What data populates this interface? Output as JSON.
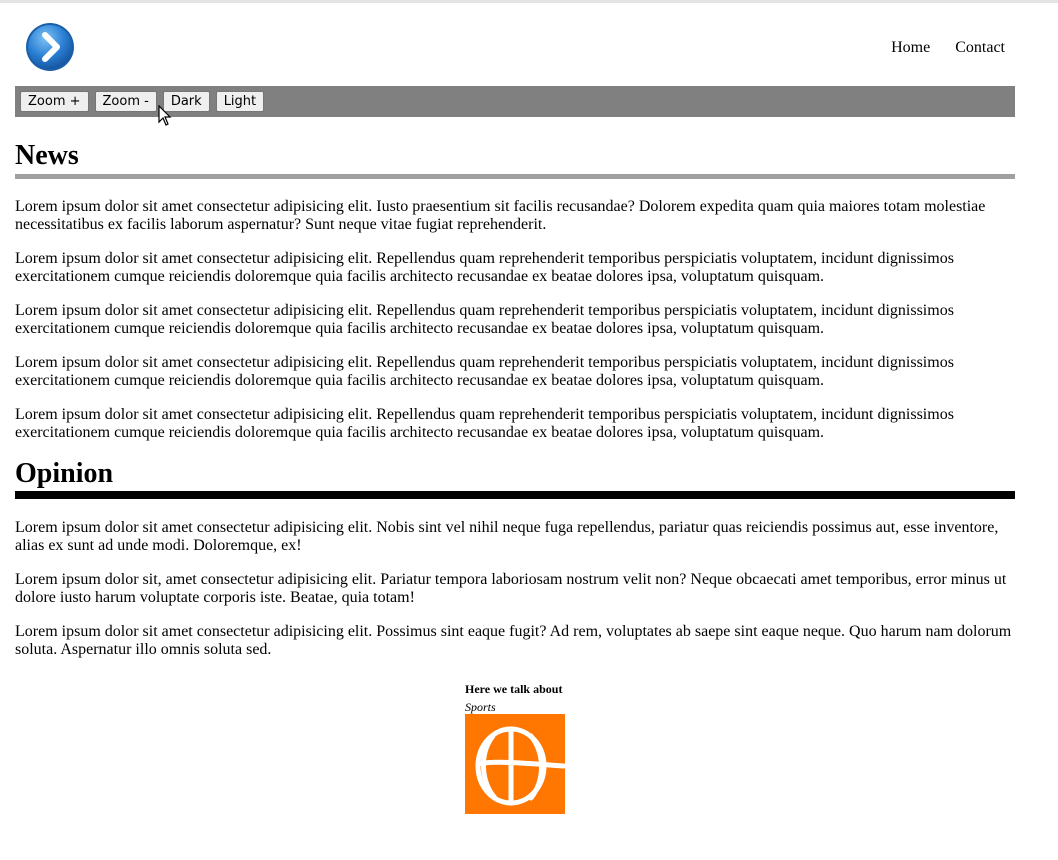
{
  "nav": {
    "home": "Home",
    "contact": "Contact"
  },
  "toolbar": {
    "zoom_in": "Zoom +",
    "zoom_out": "Zoom -",
    "dark": "Dark",
    "light": "Light"
  },
  "news": {
    "title": "News",
    "paragraphs": [
      "Lorem ipsum dolor sit amet consectetur adipisicing elit. Iusto praesentium sit facilis recusandae? Dolorem expedita quam quia maiores totam molestiae necessitatibus ex facilis laborum aspernatur? Sunt neque vitae fugiat reprehenderit.",
      "Lorem ipsum dolor sit amet consectetur adipisicing elit. Repellendus quam reprehenderit temporibus perspiciatis voluptatem, incidunt dignissimos exercitationem cumque reiciendis doloremque quia facilis architecto recusandae ex beatae dolores ipsa, voluptatum quisquam.",
      "Lorem ipsum dolor sit amet consectetur adipisicing elit. Repellendus quam reprehenderit temporibus perspiciatis voluptatem, incidunt dignissimos exercitationem cumque reiciendis doloremque quia facilis architecto recusandae ex beatae dolores ipsa, voluptatum quisquam.",
      "Lorem ipsum dolor sit amet consectetur adipisicing elit. Repellendus quam reprehenderit temporibus perspiciatis voluptatem, incidunt dignissimos exercitationem cumque reiciendis doloremque quia facilis architecto recusandae ex beatae dolores ipsa, voluptatum quisquam.",
      "Lorem ipsum dolor sit amet consectetur adipisicing elit. Repellendus quam reprehenderit temporibus perspiciatis voluptatem, incidunt dignissimos exercitationem cumque reiciendis doloremque quia facilis architecto recusandae ex beatae dolores ipsa, voluptatum quisquam."
    ]
  },
  "opinion": {
    "title": "Opinion",
    "paragraphs": [
      "Lorem ipsum dolor sit amet consectetur adipisicing elit. Nobis sint vel nihil neque fuga repellendus, pariatur quas reiciendis possimus aut, esse inventore, alias ex sunt ad unde modi. Doloremque, ex!",
      "Lorem ipsum dolor sit, amet consectetur adipisicing elit. Pariatur tempora laboriosam nostrum velit non? Neque obcaecati amet temporibus, error minus ut dolore iusto harum voluptate corporis iste. Beatae, quia totam!",
      "Lorem ipsum dolor sit amet consectetur adipisicing elit. Possimus sint eaque fugit? Ad rem, voluptates ab saepe sint eaque neque. Quo harum nam dolorum soluta. Aspernatur illo omnis soluta sed."
    ]
  },
  "figure": {
    "title": "Here we talk about",
    "subtitle": "Sports",
    "icon": "basketball-icon"
  },
  "logo": {
    "icon": "chevron-right-icon"
  },
  "colors": {
    "toolbar_bg": "#808080",
    "news_rule": "#a0a0a0",
    "opinion_rule": "#000000",
    "sports_bg": "#ff7700",
    "logo_blue": "#2a7fd4"
  }
}
